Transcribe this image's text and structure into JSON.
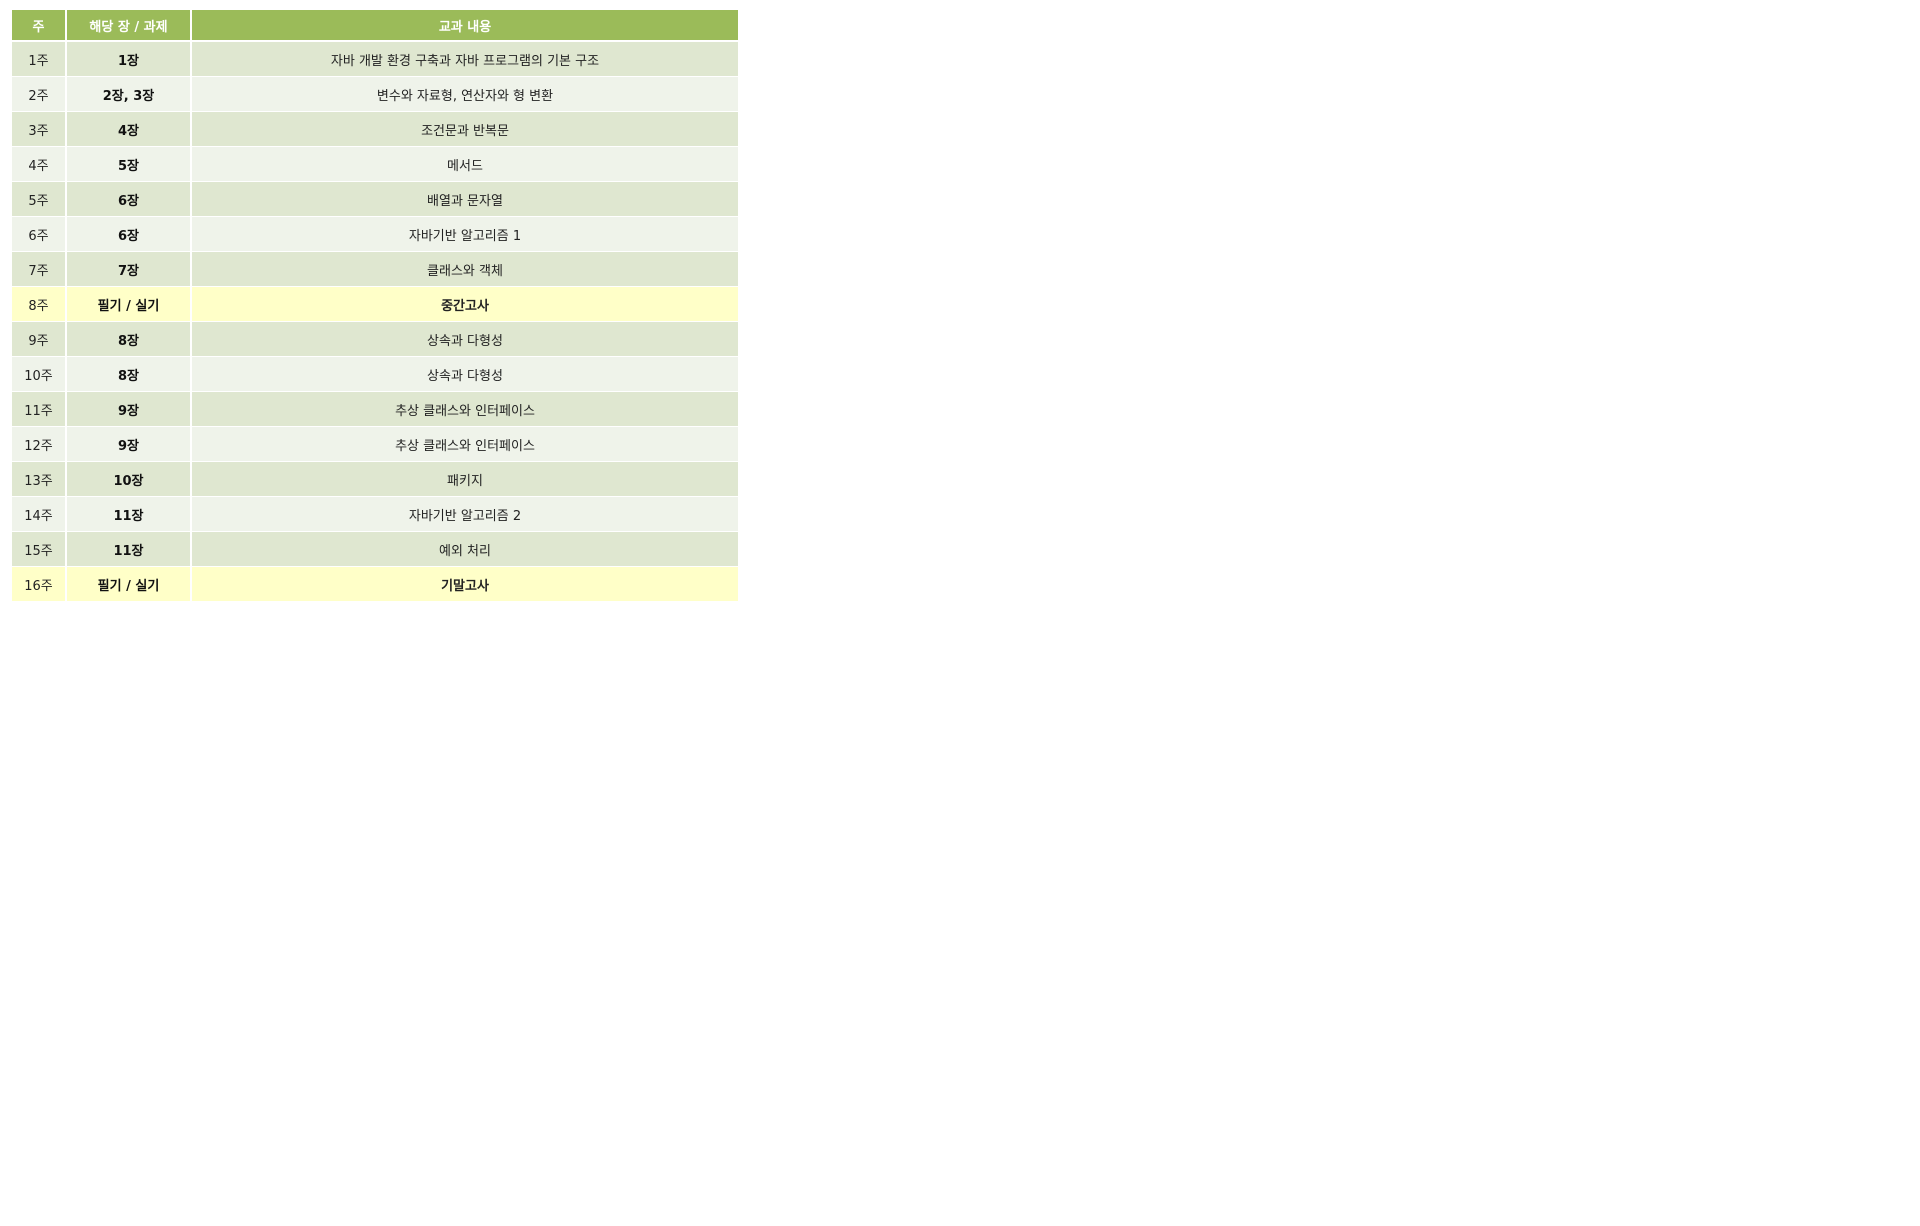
{
  "table": {
    "headers": {
      "week": "주",
      "chapter": "해당 장 / 과제",
      "content": "교과 내용"
    },
    "rows": [
      {
        "week": "1주",
        "chapter": "1장",
        "content": "자바 개발 환경 구축과 자바 프로그램의 기본 구조"
      },
      {
        "week": "2주",
        "chapter": "2장, 3장",
        "content": "변수와 자료형, 연산자와 형 변환"
      },
      {
        "week": "3주",
        "chapter": "4장",
        "content": "조건문과 반복문"
      },
      {
        "week": "4주",
        "chapter": "5장",
        "content": "메서드"
      },
      {
        "week": "5주",
        "chapter": "6장",
        "content": "배열과 문자열"
      },
      {
        "week": "6주",
        "chapter": "6장",
        "content": "자바기반 알고리즘 1"
      },
      {
        "week": "7주",
        "chapter": "7장",
        "content": "클래스와 객체"
      },
      {
        "week": "8주",
        "chapter": "필기 / 실기",
        "content": "중간고사"
      },
      {
        "week": "9주",
        "chapter": "8장",
        "content": "상속과 다형성"
      },
      {
        "week": "10주",
        "chapter": "8장",
        "content": "상속과 다형성"
      },
      {
        "week": "11주",
        "chapter": "9장",
        "content": "추상 클래스와 인터페이스"
      },
      {
        "week": "12주",
        "chapter": "9장",
        "content": "추상 클래스와 인터페이스"
      },
      {
        "week": "13주",
        "chapter": "10장",
        "content": "패키지"
      },
      {
        "week": "14주",
        "chapter": "11장",
        "content": "자바기반 알고리즘 2"
      },
      {
        "week": "15주",
        "chapter": "11장",
        "content": "예외 처리"
      },
      {
        "week": "16주",
        "chapter": "필기 / 실기",
        "content": "기말고사"
      }
    ]
  },
  "colors": {
    "header_bg": "#9bbb59",
    "row_odd_bg": "#dfe7d0",
    "row_even_bg": "#eff3ea",
    "exam_row_bg": "#ffffc8"
  }
}
